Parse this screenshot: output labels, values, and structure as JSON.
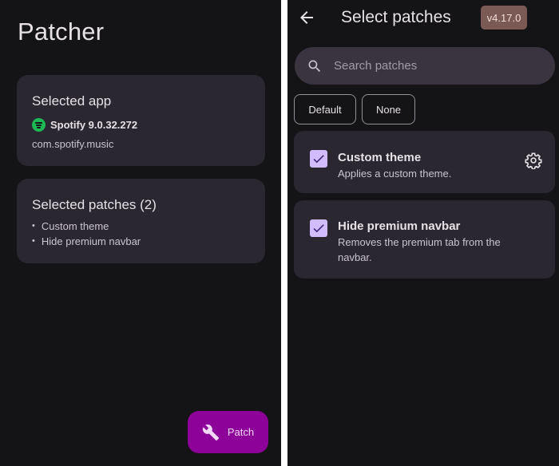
{
  "left_screen": {
    "title": "Patcher",
    "selected_app": {
      "heading": "Selected app",
      "app_icon": "spotify-icon",
      "app_name": "Spotify 9.0.32.272",
      "package": "com.spotify.music"
    },
    "selected_patches": {
      "heading": "Selected patches (2)",
      "items": [
        "Custom theme",
        "Hide premium navbar"
      ]
    },
    "fab": {
      "icon": "wrench-icon",
      "label": "Patch"
    }
  },
  "right_screen": {
    "back_icon": "arrow-back-icon",
    "title": "Select patches",
    "version": "v4.17.0",
    "search": {
      "icon": "search-icon",
      "placeholder": "Search patches"
    },
    "chips": [
      "Default",
      "None"
    ],
    "patches": [
      {
        "name": "Custom theme",
        "description": "Applies a custom theme.",
        "checked": true,
        "has_options": true
      },
      {
        "name": "Hide premium navbar",
        "description": "Removes the premium tab from the navbar.",
        "checked": true,
        "has_options": false
      }
    ]
  },
  "colors": {
    "background": "#141316",
    "card": "#2b2730",
    "fab": "#8d039a",
    "checkbox": "#d0bcff",
    "version_badge": "#7b5955",
    "spotify_green": "#1db954"
  }
}
